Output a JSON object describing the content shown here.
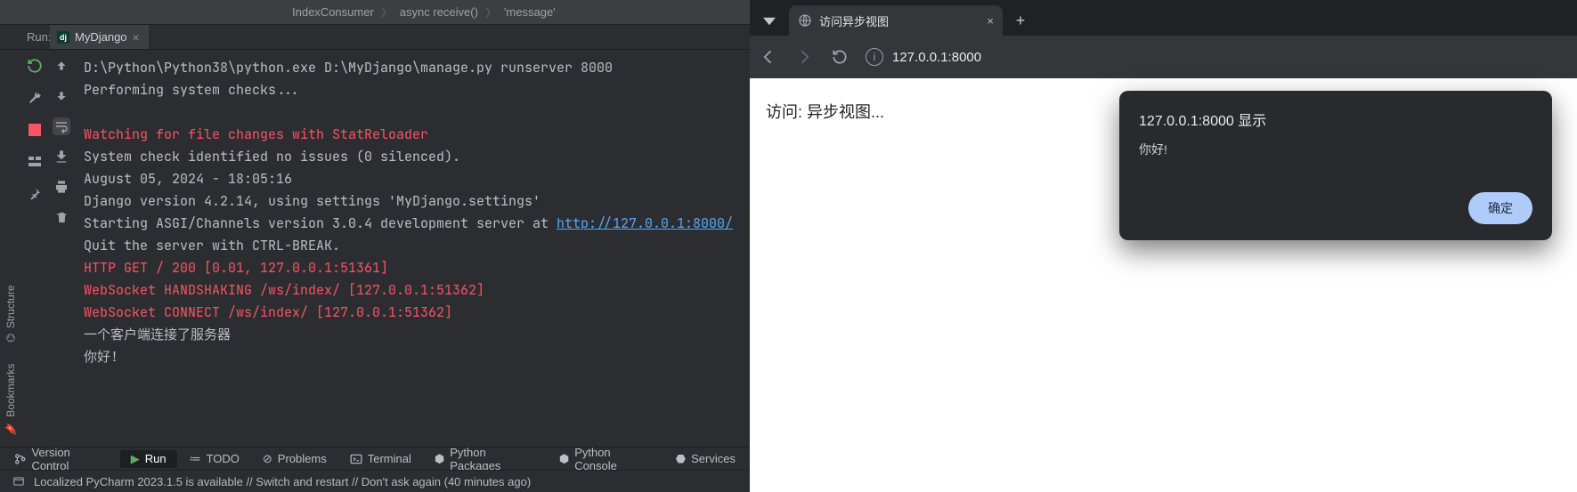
{
  "ide": {
    "breadcrumb": [
      "IndexConsumer",
      "async receive()",
      "'message'"
    ],
    "run_label": "Run:",
    "tab": {
      "name": "MyDjango"
    },
    "vrail": {
      "structure": "Structure",
      "bookmarks": "Bookmarks"
    },
    "console": {
      "l0": "D:\\Python\\Python38\\python.exe D:\\MyDjango\\manage.py runserver 8000",
      "l1": "Performing system checks...",
      "blank": "",
      "l2": "Watching for file changes with StatReloader",
      "l3": "System check identified no issues (0 silenced).",
      "l4": "August 05, 2024 - 18:05:16",
      "l5a": "Django version 4.2.14, using settings 'MyDjango.settings'",
      "l6a": "Starting ASGI/Channels version 3.0.4 development server at ",
      "l6b": "http://127.0.0.1:8000/",
      "l7": "Quit the server with CTRL-BREAK.",
      "l8": "HTTP GET / 200 [0.01, 127.0.0.1:51361]",
      "l9": "WebSocket HANDSHAKING /ws/index/ [127.0.0.1:51362]",
      "l10": "WebSocket CONNECT /ws/index/ [127.0.0.1:51362]",
      "l11": "一个客户端连接了服务器",
      "l12": "你好!"
    },
    "tools": {
      "version_control": "Version Control",
      "run": "Run",
      "todo": "TODO",
      "problems": "Problems",
      "terminal": "Terminal",
      "python_packages": "Python Packages",
      "python_console": "Python Console",
      "services": "Services"
    },
    "status_msg": "Localized PyCharm 2023.1.5 is available // Switch and restart // Don't ask again (40 minutes ago)"
  },
  "browser": {
    "tab_title": "访问异步视图",
    "url": "127.0.0.1:8000",
    "page_text": "访问: 异步视图...",
    "dialog": {
      "title": "127.0.0.1:8000 显示",
      "body": "你好!",
      "ok": "确定"
    }
  }
}
